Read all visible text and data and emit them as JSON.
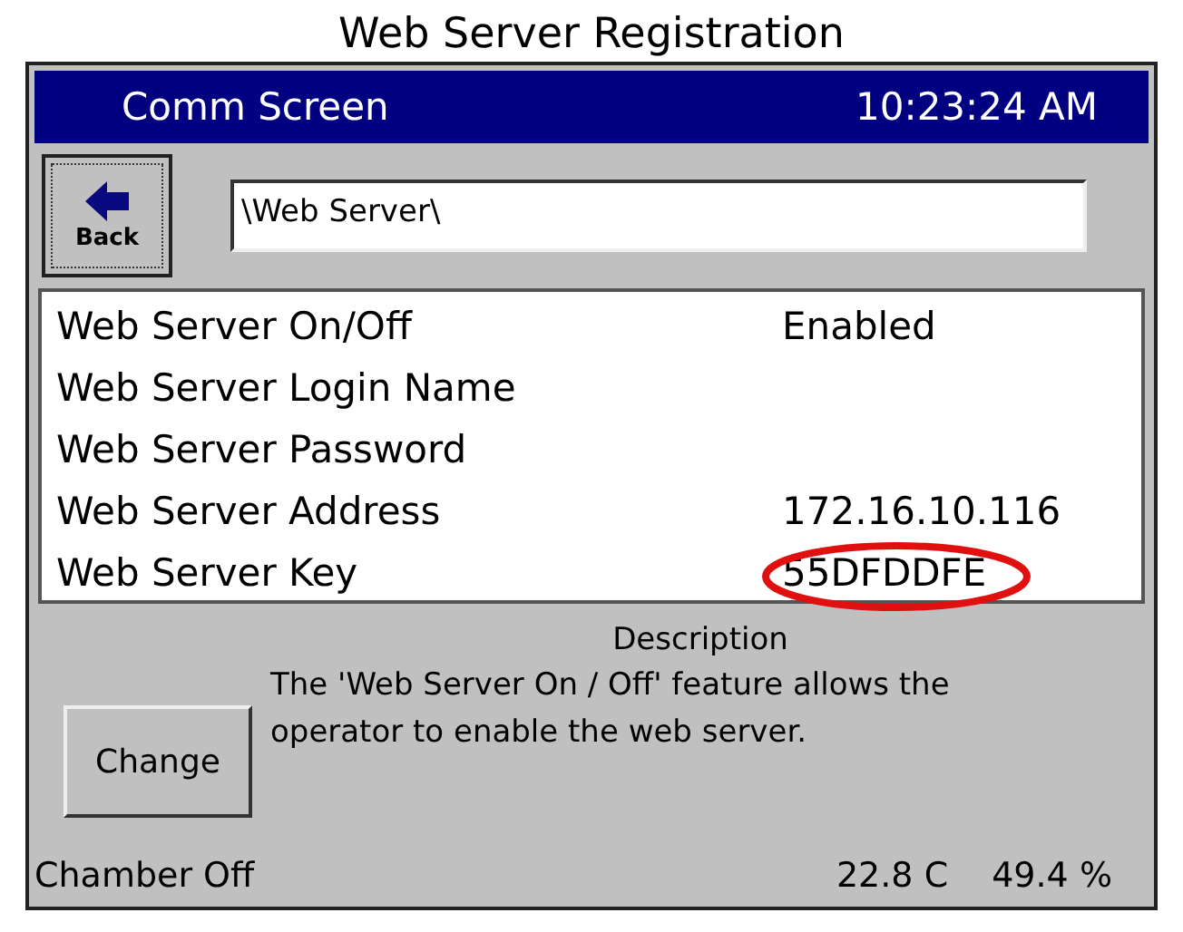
{
  "caption": "Web Server Registration",
  "title_bar": {
    "title": "Comm Screen",
    "time": "10:23:24 AM"
  },
  "back_button": {
    "label": "Back"
  },
  "path_field": {
    "value": "\\Web Server\\"
  },
  "settings": [
    {
      "name": "Web Server On/Off",
      "value": "Enabled",
      "highlighted": false
    },
    {
      "name": "Web Server Login Name",
      "highlighted": false
    },
    {
      "name": "Web Server Password",
      "highlighted": false
    },
    {
      "name": "Web Server Address",
      "value": "172.16.10.116",
      "highlighted": false
    },
    {
      "name": "Web Server Key",
      "value": "55DFDDFE",
      "highlighted": true
    }
  ],
  "description": {
    "heading": "Description",
    "text": "The 'Web Server On / Off' feature allows the operator to enable the web server."
  },
  "change_button": {
    "label": "Change"
  },
  "status_bar": {
    "chamber": "Chamber Off",
    "temperature": "22.8 C",
    "humidity": "49.4 %"
  }
}
